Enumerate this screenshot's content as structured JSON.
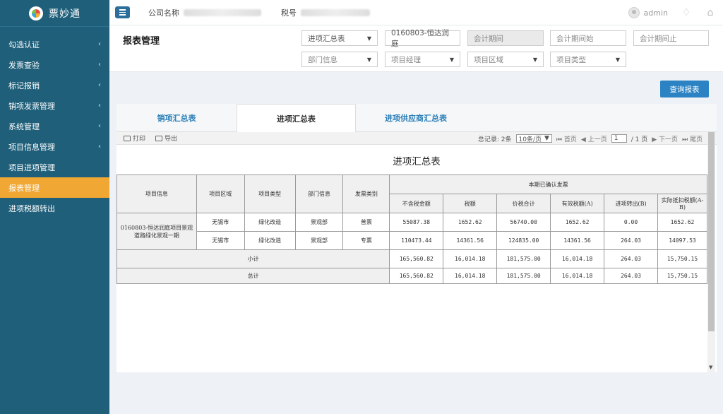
{
  "brand": {
    "title": "票妙通"
  },
  "sidebar": {
    "items": [
      {
        "label": "勾选认证",
        "chevron": true
      },
      {
        "label": "发票查验",
        "chevron": true
      },
      {
        "label": "标记报销",
        "chevron": true
      },
      {
        "label": "销项发票管理",
        "chevron": true
      },
      {
        "label": "系统管理",
        "chevron": true
      },
      {
        "label": "项目信息管理",
        "chevron": true
      },
      {
        "label": "项目进项管理",
        "chevron": false
      },
      {
        "label": "报表管理",
        "chevron": false,
        "active": true
      },
      {
        "label": "进项税额转出",
        "chevron": false
      }
    ],
    "chevron_glyph": "‹"
  },
  "topbar": {
    "company_label": "公司名称",
    "tax_label": "税号",
    "user": "admin"
  },
  "header": {
    "title": "报表管理",
    "report_type": "进项汇总表",
    "project": "0160803-恒达润庭",
    "period_placeholder": "会计期间",
    "period_start_placeholder": "会计期间始",
    "period_end_placeholder": "会计期间止",
    "department_placeholder": "部门信息",
    "manager_placeholder": "项目经理",
    "region_placeholder": "项目区域",
    "category_placeholder": "项目类型",
    "query_button": "查询报表"
  },
  "tabs": [
    {
      "label": "销项汇总表"
    },
    {
      "label": "进项汇总表",
      "active": true
    },
    {
      "label": "进项供应商汇总表"
    }
  ],
  "toolbar": {
    "print": "打印",
    "export": "导出",
    "total_records": "总记录: 2条",
    "page_size": "10条/页",
    "first": "首页",
    "prev": "上一页",
    "page_input": "1",
    "page_of": "/ 1 页",
    "next": "下一页",
    "last": "尾页"
  },
  "report": {
    "title": "进项汇总表",
    "headers": {
      "project_info": "项目信息",
      "region": "项目区域",
      "type": "项目类型",
      "department": "部门信息",
      "invoice_type": "发票类别",
      "group": "本期已确认发票",
      "cols": [
        "不含税金额",
        "税额",
        "价税合计",
        "有效税额(A)",
        "进项转出(B)",
        "实际抵扣税额(A-B)"
      ]
    },
    "project_name": "0160803-恒达润庭项目景观道路绿化景观一期",
    "rows": [
      {
        "region": "无锡市",
        "type": "绿化改造",
        "department": "景观部",
        "invoice_type": "普票",
        "values": [
          "55087.38",
          "1652.62",
          "56740.00",
          "1652.62",
          "0.00",
          "1652.62"
        ]
      },
      {
        "region": "无锡市",
        "type": "绿化改造",
        "department": "景观部",
        "invoice_type": "专票",
        "values": [
          "110473.44",
          "14361.56",
          "124835.00",
          "14361.56",
          "264.03",
          "14097.53"
        ]
      }
    ],
    "subtotal": {
      "label": "小计",
      "values": [
        "165,560.82",
        "16,014.18",
        "181,575.00",
        "16,014.18",
        "264.03",
        "15,750.15"
      ]
    },
    "total": {
      "label": "总计",
      "values": [
        "165,560.82",
        "16,014.18",
        "181,575.00",
        "16,014.18",
        "264.03",
        "15,750.15"
      ]
    }
  },
  "colors": {
    "sidebar": "#1f5f7a",
    "active": "#f0a733",
    "primary": "#2b83c4"
  }
}
